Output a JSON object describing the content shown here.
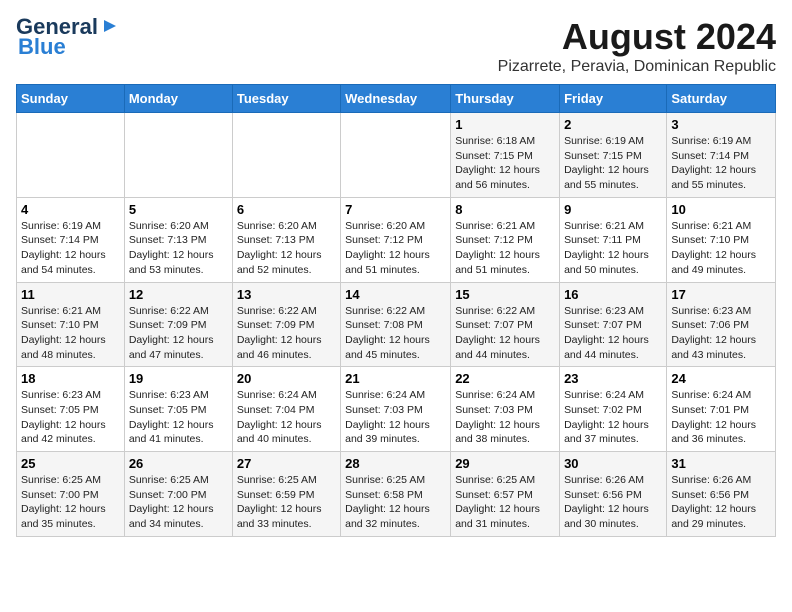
{
  "header": {
    "logo_line1": "General",
    "logo_line2": "Blue",
    "title": "August 2024",
    "subtitle": "Pizarrete, Peravia, Dominican Republic"
  },
  "calendar": {
    "days_of_week": [
      "Sunday",
      "Monday",
      "Tuesday",
      "Wednesday",
      "Thursday",
      "Friday",
      "Saturday"
    ],
    "weeks": [
      [
        {
          "day": "",
          "info": ""
        },
        {
          "day": "",
          "info": ""
        },
        {
          "day": "",
          "info": ""
        },
        {
          "day": "",
          "info": ""
        },
        {
          "day": "1",
          "info": "Sunrise: 6:18 AM\nSunset: 7:15 PM\nDaylight: 12 hours\nand 56 minutes."
        },
        {
          "day": "2",
          "info": "Sunrise: 6:19 AM\nSunset: 7:15 PM\nDaylight: 12 hours\nand 55 minutes."
        },
        {
          "day": "3",
          "info": "Sunrise: 6:19 AM\nSunset: 7:14 PM\nDaylight: 12 hours\nand 55 minutes."
        }
      ],
      [
        {
          "day": "4",
          "info": "Sunrise: 6:19 AM\nSunset: 7:14 PM\nDaylight: 12 hours\nand 54 minutes."
        },
        {
          "day": "5",
          "info": "Sunrise: 6:20 AM\nSunset: 7:13 PM\nDaylight: 12 hours\nand 53 minutes."
        },
        {
          "day": "6",
          "info": "Sunrise: 6:20 AM\nSunset: 7:13 PM\nDaylight: 12 hours\nand 52 minutes."
        },
        {
          "day": "7",
          "info": "Sunrise: 6:20 AM\nSunset: 7:12 PM\nDaylight: 12 hours\nand 51 minutes."
        },
        {
          "day": "8",
          "info": "Sunrise: 6:21 AM\nSunset: 7:12 PM\nDaylight: 12 hours\nand 51 minutes."
        },
        {
          "day": "9",
          "info": "Sunrise: 6:21 AM\nSunset: 7:11 PM\nDaylight: 12 hours\nand 50 minutes."
        },
        {
          "day": "10",
          "info": "Sunrise: 6:21 AM\nSunset: 7:10 PM\nDaylight: 12 hours\nand 49 minutes."
        }
      ],
      [
        {
          "day": "11",
          "info": "Sunrise: 6:21 AM\nSunset: 7:10 PM\nDaylight: 12 hours\nand 48 minutes."
        },
        {
          "day": "12",
          "info": "Sunrise: 6:22 AM\nSunset: 7:09 PM\nDaylight: 12 hours\nand 47 minutes."
        },
        {
          "day": "13",
          "info": "Sunrise: 6:22 AM\nSunset: 7:09 PM\nDaylight: 12 hours\nand 46 minutes."
        },
        {
          "day": "14",
          "info": "Sunrise: 6:22 AM\nSunset: 7:08 PM\nDaylight: 12 hours\nand 45 minutes."
        },
        {
          "day": "15",
          "info": "Sunrise: 6:22 AM\nSunset: 7:07 PM\nDaylight: 12 hours\nand 44 minutes."
        },
        {
          "day": "16",
          "info": "Sunrise: 6:23 AM\nSunset: 7:07 PM\nDaylight: 12 hours\nand 44 minutes."
        },
        {
          "day": "17",
          "info": "Sunrise: 6:23 AM\nSunset: 7:06 PM\nDaylight: 12 hours\nand 43 minutes."
        }
      ],
      [
        {
          "day": "18",
          "info": "Sunrise: 6:23 AM\nSunset: 7:05 PM\nDaylight: 12 hours\nand 42 minutes."
        },
        {
          "day": "19",
          "info": "Sunrise: 6:23 AM\nSunset: 7:05 PM\nDaylight: 12 hours\nand 41 minutes."
        },
        {
          "day": "20",
          "info": "Sunrise: 6:24 AM\nSunset: 7:04 PM\nDaylight: 12 hours\nand 40 minutes."
        },
        {
          "day": "21",
          "info": "Sunrise: 6:24 AM\nSunset: 7:03 PM\nDaylight: 12 hours\nand 39 minutes."
        },
        {
          "day": "22",
          "info": "Sunrise: 6:24 AM\nSunset: 7:03 PM\nDaylight: 12 hours\nand 38 minutes."
        },
        {
          "day": "23",
          "info": "Sunrise: 6:24 AM\nSunset: 7:02 PM\nDaylight: 12 hours\nand 37 minutes."
        },
        {
          "day": "24",
          "info": "Sunrise: 6:24 AM\nSunset: 7:01 PM\nDaylight: 12 hours\nand 36 minutes."
        }
      ],
      [
        {
          "day": "25",
          "info": "Sunrise: 6:25 AM\nSunset: 7:00 PM\nDaylight: 12 hours\nand 35 minutes."
        },
        {
          "day": "26",
          "info": "Sunrise: 6:25 AM\nSunset: 7:00 PM\nDaylight: 12 hours\nand 34 minutes."
        },
        {
          "day": "27",
          "info": "Sunrise: 6:25 AM\nSunset: 6:59 PM\nDaylight: 12 hours\nand 33 minutes."
        },
        {
          "day": "28",
          "info": "Sunrise: 6:25 AM\nSunset: 6:58 PM\nDaylight: 12 hours\nand 32 minutes."
        },
        {
          "day": "29",
          "info": "Sunrise: 6:25 AM\nSunset: 6:57 PM\nDaylight: 12 hours\nand 31 minutes."
        },
        {
          "day": "30",
          "info": "Sunrise: 6:26 AM\nSunset: 6:56 PM\nDaylight: 12 hours\nand 30 minutes."
        },
        {
          "day": "31",
          "info": "Sunrise: 6:26 AM\nSunset: 6:56 PM\nDaylight: 12 hours\nand 29 minutes."
        }
      ]
    ]
  }
}
